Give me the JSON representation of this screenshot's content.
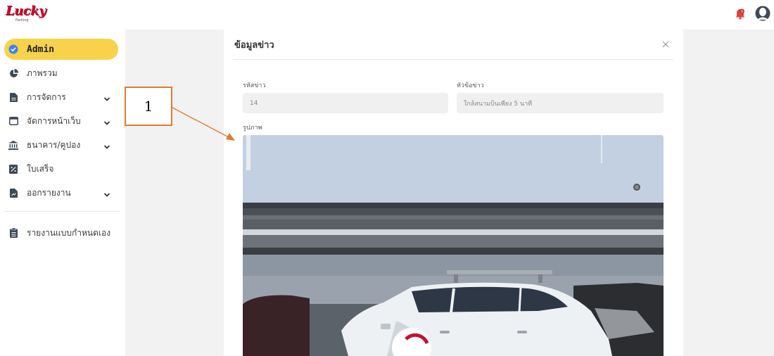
{
  "header": {
    "logo_text": "Lucky",
    "logo_subtext": "Parking"
  },
  "sidebar": {
    "items": [
      {
        "label": "Admin",
        "icon": "check-badge-icon",
        "active": true
      },
      {
        "label": "ภาพรวม",
        "icon": "pie-chart-icon"
      },
      {
        "label": "การจัดการ",
        "icon": "document-icon",
        "has_dropdown": true
      },
      {
        "label": "จัดการหน้าเว็บ",
        "icon": "browser-window-icon",
        "has_dropdown": true
      },
      {
        "label": "ธนาคาร/คูปอง",
        "icon": "bank-icon",
        "has_dropdown": true
      },
      {
        "label": "ใบเสร็จ",
        "icon": "receipt-icon"
      },
      {
        "label": "ออกรายงาน",
        "icon": "report-file-icon",
        "has_dropdown": true
      },
      {
        "label": "รายงานแบบกำหนดเอง",
        "icon": "clipboard-icon"
      }
    ]
  },
  "modal": {
    "title": "ข้อมูลข่าว",
    "fields": {
      "news_id": {
        "label": "รหัสข่าว",
        "value": "14"
      },
      "headline": {
        "label": "หัวข้อข่าว",
        "value": "ใกล้สนามบินเพียง 5 นาที"
      },
      "image": {
        "label": "รูปภาพ"
      }
    }
  },
  "annotation": {
    "callout_number": "1"
  },
  "colors": {
    "accent": "#f7d24a",
    "brand_red": "#c8102e",
    "callout_orange": "#e07b30"
  }
}
